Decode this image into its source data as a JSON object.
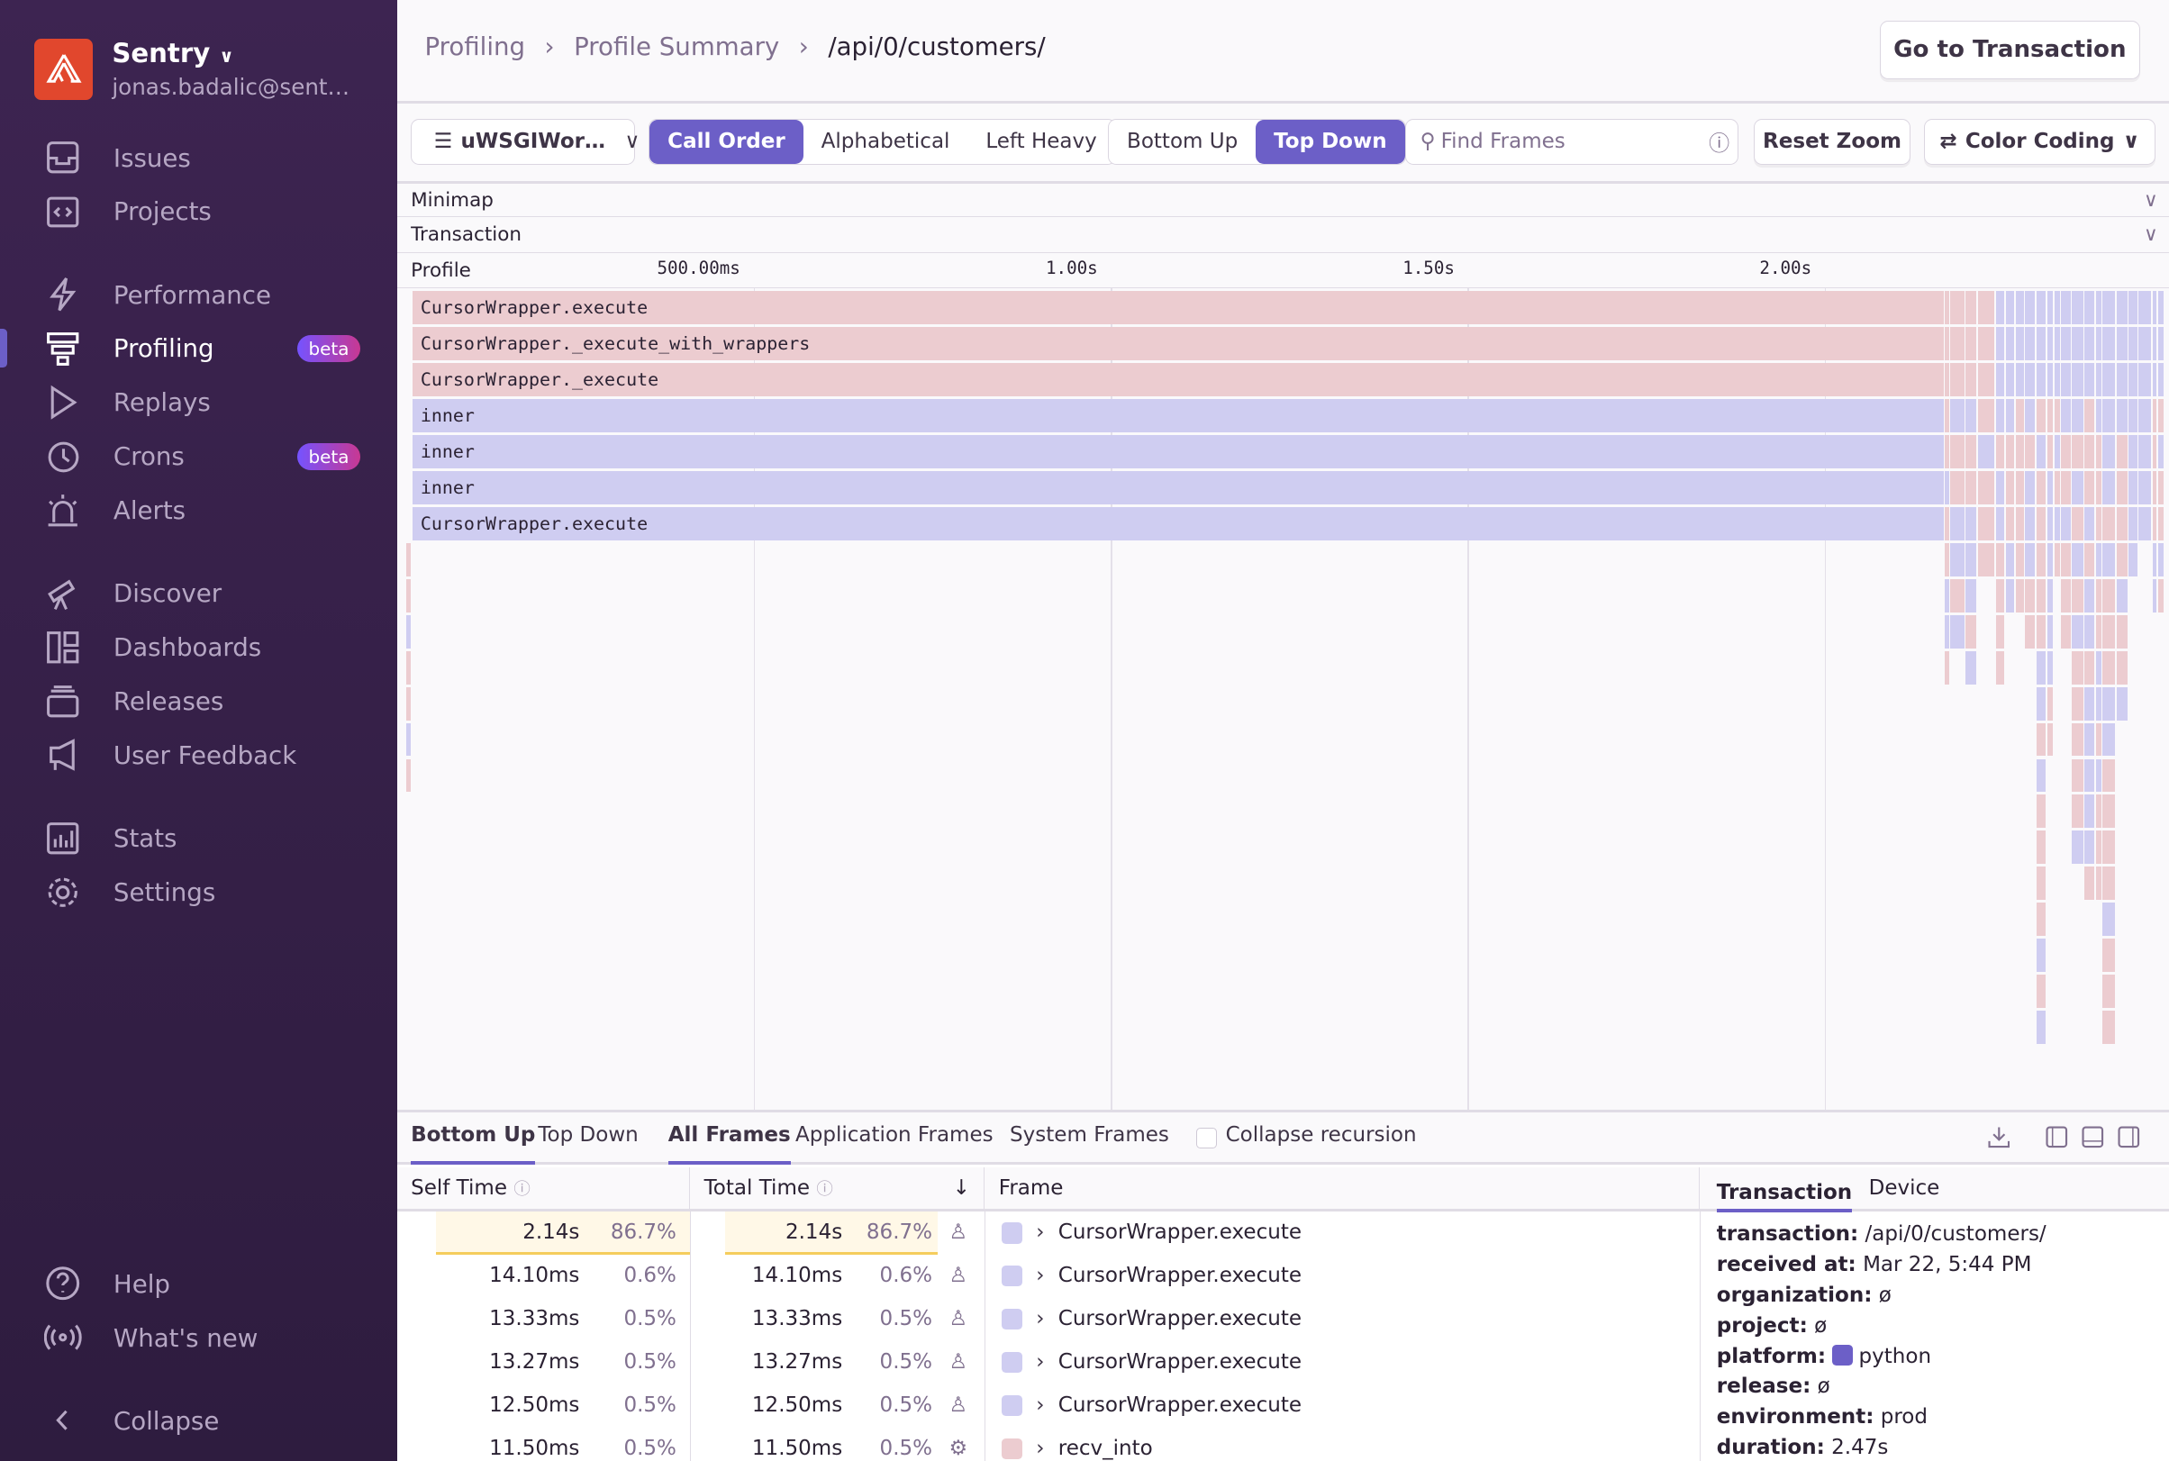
{
  "sidebar": {
    "org_name": "Sentry",
    "org_email": "jonas.badalic@sent…",
    "items": [
      {
        "label": "Issues",
        "icon": "inbox-icon"
      },
      {
        "label": "Projects",
        "icon": "code-folder-icon"
      },
      {
        "label": "Performance",
        "icon": "lightning-icon"
      },
      {
        "label": "Profiling",
        "icon": "profiling-icon",
        "badge": "beta",
        "active": true
      },
      {
        "label": "Replays",
        "icon": "play-icon"
      },
      {
        "label": "Crons",
        "icon": "history-icon",
        "badge": "beta"
      },
      {
        "label": "Alerts",
        "icon": "siren-icon"
      },
      {
        "label": "Discover",
        "icon": "telescope-icon"
      },
      {
        "label": "Dashboards",
        "icon": "dashboard-icon"
      },
      {
        "label": "Releases",
        "icon": "box-icon"
      },
      {
        "label": "User Feedback",
        "icon": "megaphone-icon"
      },
      {
        "label": "Stats",
        "icon": "stats-icon"
      },
      {
        "label": "Settings",
        "icon": "gear-icon"
      }
    ],
    "footer": [
      {
        "label": "Help",
        "icon": "question-icon"
      },
      {
        "label": "What's new",
        "icon": "broadcast-icon"
      },
      {
        "label": "Collapse",
        "icon": "chevron-left-icon"
      }
    ]
  },
  "breadcrumbs": [
    "Profiling",
    "Profile Summary",
    "/api/0/customers/"
  ],
  "go_to_transaction": "Go to Transaction",
  "toolbar": {
    "thread": "uWSGIWor…",
    "sort": [
      "Call Order",
      "Alphabetical",
      "Left Heavy"
    ],
    "sort_selected": "Call Order",
    "view": [
      "Bottom Up",
      "Top Down"
    ],
    "view_selected": "Top Down",
    "search_placeholder": "Find Frames",
    "reset_zoom": "Reset Zoom",
    "color_coding": "Color Coding"
  },
  "sections": {
    "minimap": "Minimap",
    "transaction": "Transaction",
    "profile": "Profile"
  },
  "flamegraph": {
    "ticks": [
      "500.00ms",
      "1.00s",
      "1.50s",
      "2.00s"
    ],
    "colors": {
      "application": "#ecccd0",
      "system": "#cfcdf1"
    },
    "frames": [
      {
        "name": "CursorWrapper.execute",
        "type": "application"
      },
      {
        "name": "CursorWrapper._execute_with_wrappers",
        "type": "application"
      },
      {
        "name": "CursorWrapper._execute",
        "type": "application"
      },
      {
        "name": "inner",
        "type": "system"
      },
      {
        "name": "inner",
        "type": "system"
      },
      {
        "name": "inner",
        "type": "system"
      },
      {
        "name": "CursorWrapper.execute",
        "type": "system"
      }
    ]
  },
  "bottom": {
    "tabs1": [
      "Bottom Up",
      "Top Down"
    ],
    "tabs2": [
      "All Frames",
      "Application Frames",
      "System Frames"
    ],
    "collapse_recursion": "Collapse recursion",
    "columns": [
      "Self Time",
      "Total Time",
      "Frame"
    ],
    "rows": [
      {
        "self": "2.14s",
        "self_pct": "86.7%",
        "total": "2.14s",
        "total_pct": "86.7%",
        "frame": "CursorWrapper.execute",
        "kind": "user",
        "color": "#cfcdf1"
      },
      {
        "self": "14.10ms",
        "self_pct": "0.6%",
        "total": "14.10ms",
        "total_pct": "0.6%",
        "frame": "CursorWrapper.execute",
        "kind": "user",
        "color": "#cfcdf1"
      },
      {
        "self": "13.33ms",
        "self_pct": "0.5%",
        "total": "13.33ms",
        "total_pct": "0.5%",
        "frame": "CursorWrapper.execute",
        "kind": "user",
        "color": "#cfcdf1"
      },
      {
        "self": "13.27ms",
        "self_pct": "0.5%",
        "total": "13.27ms",
        "total_pct": "0.5%",
        "frame": "CursorWrapper.execute",
        "kind": "user",
        "color": "#cfcdf1"
      },
      {
        "self": "12.50ms",
        "self_pct": "0.5%",
        "total": "12.50ms",
        "total_pct": "0.5%",
        "frame": "CursorWrapper.execute",
        "kind": "user",
        "color": "#cfcdf1"
      },
      {
        "self": "11.50ms",
        "self_pct": "0.5%",
        "total": "11.50ms",
        "total_pct": "0.5%",
        "frame": "recv_into",
        "kind": "system",
        "color": "#ecccd0"
      }
    ],
    "details_tabs": [
      "Transaction",
      "Device"
    ],
    "details": [
      {
        "k": "transaction:",
        "v": "/api/0/customers/"
      },
      {
        "k": "received at:",
        "v": "Mar 22, 5:44 PM"
      },
      {
        "k": "organization:",
        "v": "ø"
      },
      {
        "k": "project:",
        "v": "ø"
      },
      {
        "k": "platform:",
        "v": "python"
      },
      {
        "k": "release:",
        "v": "ø"
      },
      {
        "k": "environment:",
        "v": "prod"
      },
      {
        "k": "duration:",
        "v": "2.47s"
      }
    ]
  }
}
